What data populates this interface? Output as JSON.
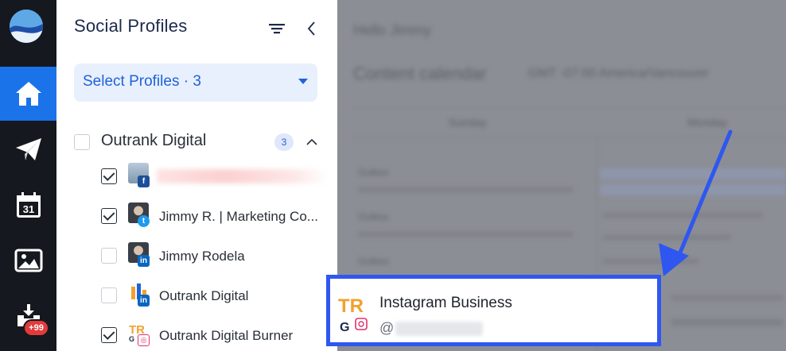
{
  "colors": {
    "rail_bg": "#15181e",
    "rail_active": "#1a73e8",
    "accent": "#2162d8",
    "select_bg": "#e8f0fd",
    "dim_overlay": "#8c8e95",
    "callout_border": "#2f57f0",
    "badge_red": "#e23b3b"
  },
  "rail": {
    "items": [
      {
        "icon": "home-icon",
        "active": true
      },
      {
        "icon": "paper-plane-icon",
        "active": false
      },
      {
        "icon": "calendar-icon",
        "active": false,
        "day": "31"
      },
      {
        "icon": "image-icon",
        "active": false
      },
      {
        "icon": "inbox-download-icon",
        "active": false,
        "badge": "+99"
      }
    ]
  },
  "panel": {
    "title": "Social Profiles",
    "select_label": "Select Profiles · 3",
    "group": {
      "label": "Outrank Digital",
      "count": "3",
      "expanded": true
    },
    "profiles": [
      {
        "name": "",
        "network": "facebook",
        "network_glyph": "f",
        "checked": true,
        "redacted": true
      },
      {
        "name": "Jimmy R. | Marketing Co...",
        "network": "twitter",
        "network_glyph": "t",
        "checked": true
      },
      {
        "name": "Jimmy Rodela",
        "network": "linkedin",
        "network_glyph": "in",
        "checked": false
      },
      {
        "name": "Outrank Digital",
        "network": "linkedin",
        "network_glyph": "in",
        "checked": false
      },
      {
        "name": "Outrank Digital Burner",
        "network": "instagram",
        "network_glyph": "◎",
        "checked": true
      }
    ]
  },
  "popup": {
    "title": "Instagram Business",
    "handle_prefix": "@",
    "logo_letters": "TR",
    "logo_sub": "G"
  },
  "background": {
    "line1": "Hello Jimmy",
    "line2": "Content calendar",
    "line2b": "GMT -07:00 America/Vancouver",
    "col1": "Sunday",
    "col2": "Monday",
    "small": "Outbox"
  }
}
